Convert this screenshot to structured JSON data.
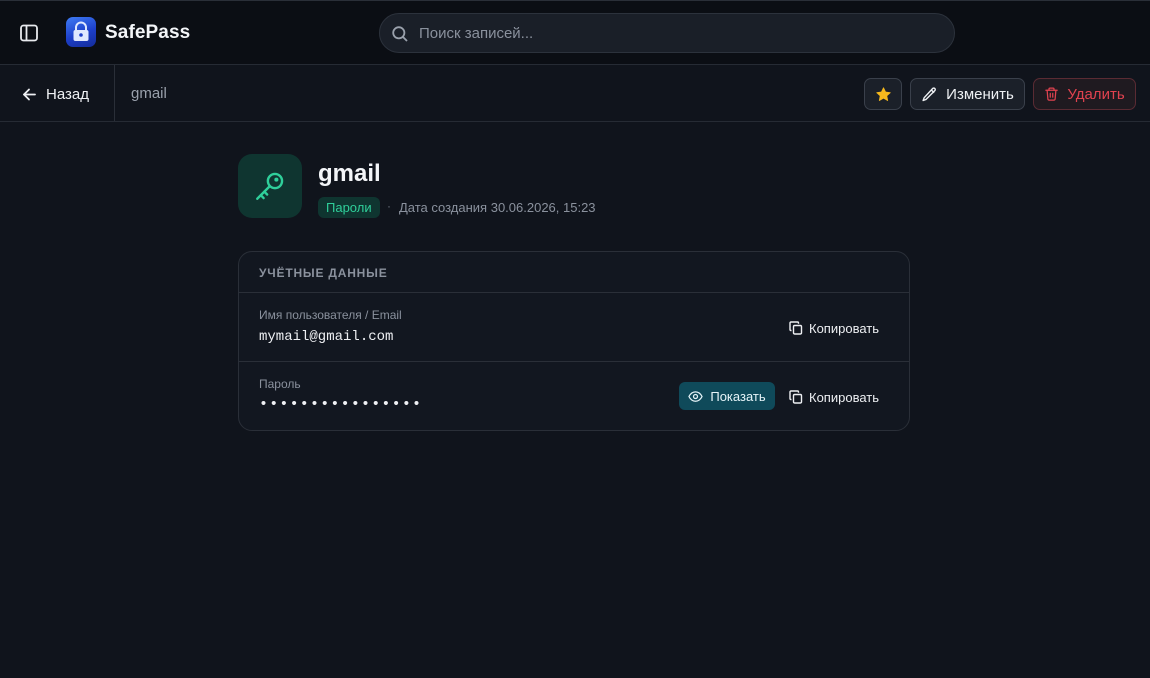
{
  "app": {
    "name": "SafePass"
  },
  "search": {
    "placeholder": "Поиск записей..."
  },
  "nav": {
    "back_label": "Назад",
    "breadcrumb": "gmail"
  },
  "actions": {
    "edit_label": "Изменить",
    "delete_label": "Удалить",
    "favorite_icon": "star-icon"
  },
  "entry": {
    "title": "gmail",
    "category": "Пароли",
    "meta_separator": "·",
    "created_text": "Дата создания 30.06.2026, 15:23"
  },
  "credentials": {
    "section_title": "УЧЁТНЫЕ ДАННЫЕ",
    "username": {
      "label": "Имя пользователя / Email",
      "value": "mymail@gmail.com",
      "copy_label": "Копировать"
    },
    "password": {
      "label": "Пароль",
      "masked_value": "••••••••••••••••",
      "show_label": "Показать",
      "copy_label": "Копировать"
    }
  },
  "colors": {
    "background": "#10141c",
    "accent_green": "#2fcf9a",
    "danger": "#e0424f",
    "star": "#f5b81d",
    "show_button": "#0f4a5a",
    "logo_blue": "#2f5fe6"
  }
}
